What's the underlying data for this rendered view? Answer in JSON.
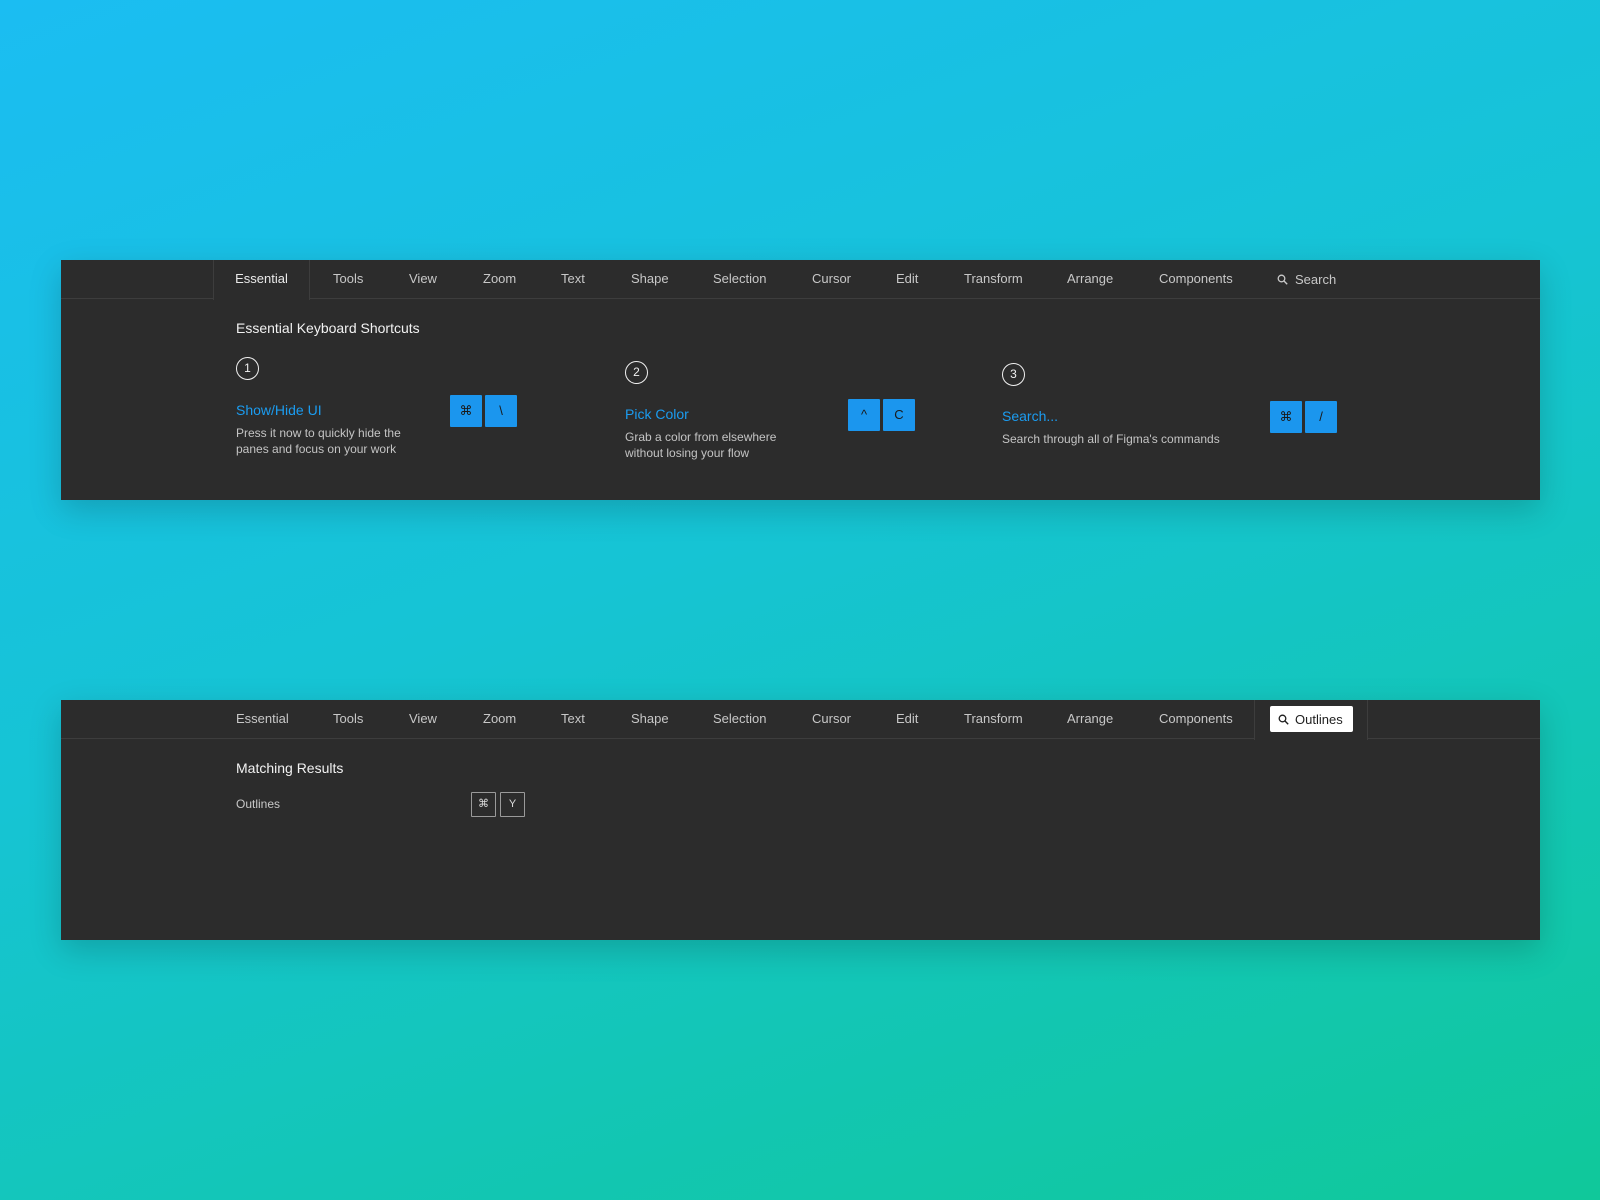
{
  "tabs": [
    {
      "label": "Essential"
    },
    {
      "label": "Tools"
    },
    {
      "label": "View"
    },
    {
      "label": "Zoom"
    },
    {
      "label": "Text"
    },
    {
      "label": "Shape"
    },
    {
      "label": "Selection"
    },
    {
      "label": "Cursor"
    },
    {
      "label": "Edit"
    },
    {
      "label": "Transform"
    },
    {
      "label": "Arrange"
    },
    {
      "label": "Components"
    }
  ],
  "panel1": {
    "active_tab": "Essential",
    "search_label": "Search",
    "title": "Essential Keyboard Shortcuts",
    "shortcuts": [
      {
        "step": "1",
        "title": "Show/Hide UI",
        "desc": "Press it now to quickly hide the panes and focus on your work",
        "keys": [
          "⌘",
          "\\"
        ]
      },
      {
        "step": "2",
        "title": "Pick Color",
        "desc": "Grab a color from elsewhere without losing your flow",
        "keys": [
          "^",
          "C"
        ]
      },
      {
        "step": "3",
        "title": "Search...",
        "desc": "Search through all of Figma's commands",
        "keys": [
          "⌘",
          "/"
        ]
      }
    ]
  },
  "panel2": {
    "search_value": "Outlines",
    "title": "Matching Results",
    "results": [
      {
        "label": "Outlines",
        "keys": [
          "⌘",
          "Y"
        ]
      }
    ]
  },
  "colors": {
    "panel_bg": "#2c2c2c",
    "accent": "#1b96ee",
    "link": "#1b9cf0"
  }
}
